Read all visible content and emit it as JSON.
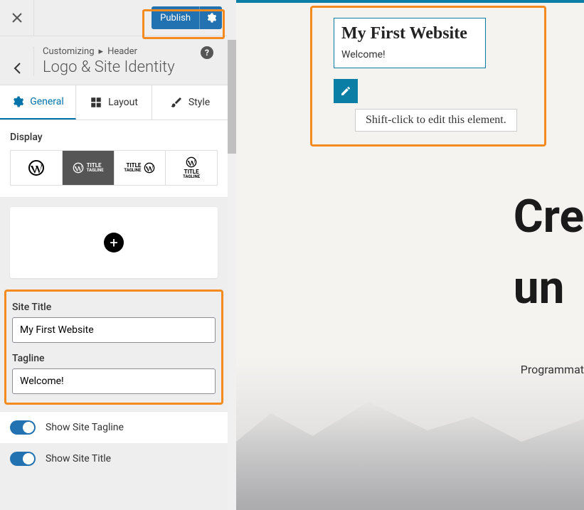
{
  "topbar": {
    "publish_label": "Publish"
  },
  "breadcrumb": {
    "customizing": "Customizing",
    "section": "Header",
    "title": "Logo & Site Identity"
  },
  "tabs": {
    "general": "General",
    "layout": "Layout",
    "style": "Style"
  },
  "display": {
    "label": "Display"
  },
  "fields": {
    "site_title_label": "Site Title",
    "site_title_value": "My First Website",
    "tagline_label": "Tagline",
    "tagline_value": "Welcome!"
  },
  "toggles": {
    "show_tagline": "Show Site Tagline",
    "show_title": "Show Site Title"
  },
  "preview": {
    "site_title": "My First Website",
    "tagline": "Welcome!",
    "tooltip": "Shift-click to edit this element.",
    "hero_line1": "Cre",
    "hero_line2": "un",
    "hero_sub": "Programmat"
  }
}
